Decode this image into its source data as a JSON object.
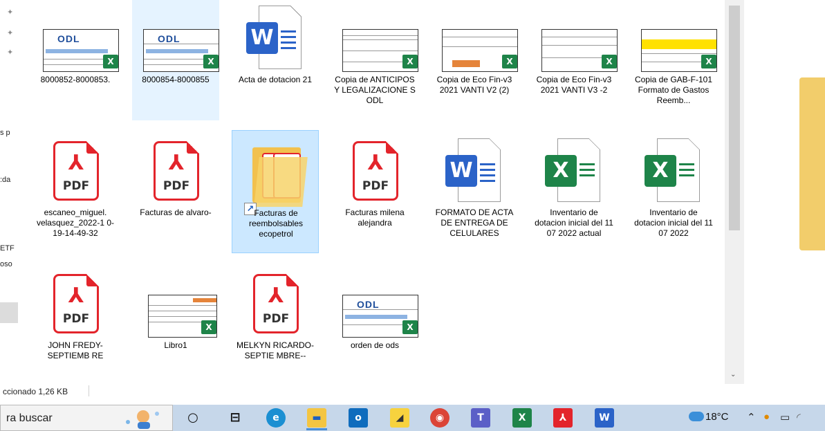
{
  "nav": {
    "fragments": [
      "s p",
      ":da",
      "ETF",
      "oso"
    ]
  },
  "files": [
    {
      "name": "8000852-8000853.",
      "kind": "excel-odl"
    },
    {
      "name": "8000854-8000855",
      "kind": "excel-odl"
    },
    {
      "name": "Acta de dotacion 21",
      "kind": "word"
    },
    {
      "name": "Copia de ANTICIPOS Y LEGALIZACIONE S ODL",
      "kind": "excel-sheet"
    },
    {
      "name": "Copia de Eco Fin-v3 2021 VANTI V2 (2)",
      "kind": "excel-sheet"
    },
    {
      "name": "Copia de Eco Fin-v3 2021 VANTI V3 -2",
      "kind": "excel-sheet"
    },
    {
      "name": "Copia de GAB-F-101 Formato de Gastos Reemb...",
      "kind": "excel-sheet"
    },
    {
      "name": "escaneo_miguel. velasquez_2022-1 0-19-14-49-32",
      "kind": "pdf"
    },
    {
      "name": "Facturas de alvaro-",
      "kind": "pdf"
    },
    {
      "name": "Facturas de reembolsables ecopetrol",
      "kind": "folder-shortcut"
    },
    {
      "name": "Facturas milena alejandra",
      "kind": "pdf"
    },
    {
      "name": "FORMATO DE ACTA DE ENTREGA DE CELULARES",
      "kind": "word"
    },
    {
      "name": "Inventario de dotacion inicial del 11 07 2022 actual",
      "kind": "excel"
    },
    {
      "name": "Inventario de dotacion inicial del 11 07 2022",
      "kind": "excel"
    },
    {
      "name": "JOHN FREDY-SEPTIEMB RE",
      "kind": "pdf"
    },
    {
      "name": "Libro1",
      "kind": "excel-sheet"
    },
    {
      "name": "MELKYN RICARDO-SEPTIE MBRE--",
      "kind": "pdf"
    },
    {
      "name": "orden de ods",
      "kind": "excel-odl"
    }
  ],
  "icons": {
    "pdf_label": "PDF",
    "word_letter": "W",
    "excel_letter": "X",
    "odl_logo": "ODL",
    "adobe_glyph": "⅄",
    "pin": "📌"
  },
  "status": {
    "text": "ccionado  1,26 KB"
  },
  "taskbar": {
    "search_placeholder": "ra buscar",
    "weather": "18°C",
    "apps": [
      "cortana",
      "task-view",
      "edge",
      "file-explorer",
      "outlook",
      "sticky-notes",
      "chrome",
      "teams",
      "excel",
      "acrobat",
      "word"
    ]
  },
  "colors": {
    "selection_bg": "#cce8ff",
    "pdf_red": "#e3242b",
    "word_blue": "#2b63c8",
    "excel_green": "#1e8449",
    "taskbar_bg": "#c6d7ea"
  }
}
